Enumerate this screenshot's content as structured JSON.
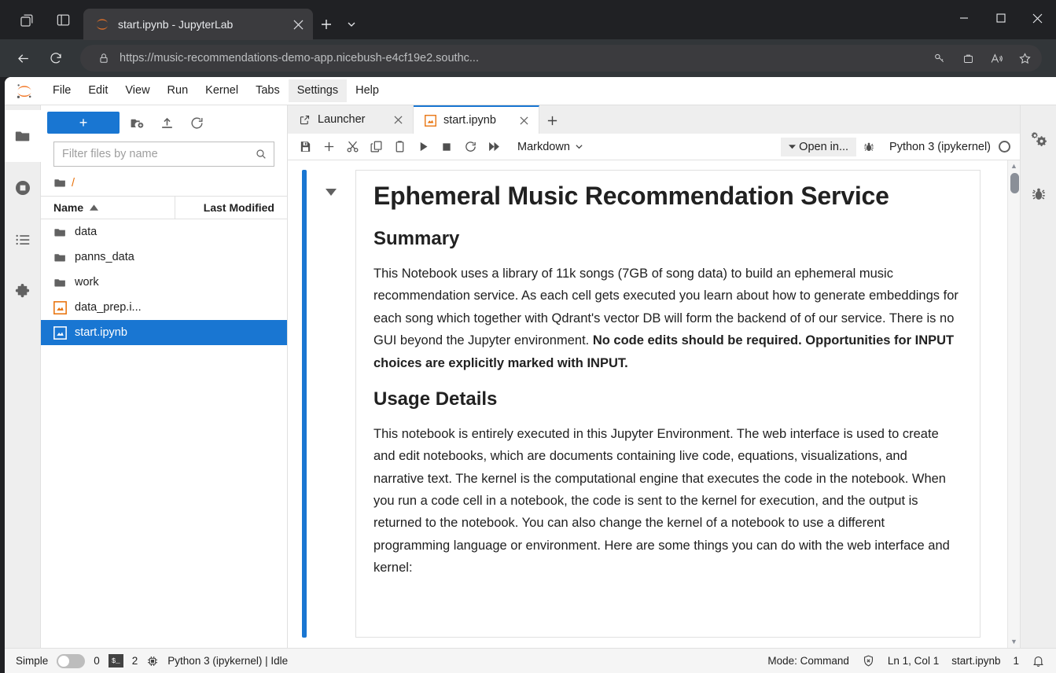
{
  "browser": {
    "tab_title": "start.ipynb - JupyterLab",
    "url": "https://music-recommendations-demo-app.nicebush-e4cf19e2.southc...",
    "icons": {
      "collections": "collections-icon",
      "split_screen": "split-screen-icon",
      "favicon": "jupyter-favicon",
      "tab_close": "close-icon",
      "new_tab": "new-tab-icon",
      "tab_list": "chevron-down-icon",
      "back": "back-arrow-icon",
      "reload": "reload-icon",
      "lock": "lock-icon",
      "key": "key-icon",
      "wallet": "wallet-icon",
      "read_aloud": "read-aloud-icon",
      "favorite": "star-icon",
      "minimize": "minimize-icon",
      "maximize": "maximize-icon",
      "close": "close-icon"
    }
  },
  "jupyter": {
    "menu": [
      {
        "label": "File",
        "active": false
      },
      {
        "label": "Edit",
        "active": false
      },
      {
        "label": "View",
        "active": false
      },
      {
        "label": "Run",
        "active": false
      },
      {
        "label": "Kernel",
        "active": false
      },
      {
        "label": "Tabs",
        "active": false
      },
      {
        "label": "Settings",
        "active": true
      },
      {
        "label": "Help",
        "active": false
      }
    ],
    "activity_bar": [
      {
        "name": "file-browser",
        "icon": "folder-icon",
        "active": true
      },
      {
        "name": "running-terminals",
        "icon": "stop-circle-icon",
        "active": false
      },
      {
        "name": "table-of-contents",
        "icon": "list-icon",
        "active": false
      },
      {
        "name": "extension-manager",
        "icon": "puzzle-icon",
        "active": false
      }
    ],
    "right_bar": [
      {
        "name": "property-inspector",
        "icon": "gears-icon"
      },
      {
        "name": "debugger",
        "icon": "bug-icon"
      }
    ],
    "file_browser": {
      "new_label": "+",
      "toolbar_icons": [
        "new-folder-icon",
        "upload-icon",
        "refresh-icon"
      ],
      "filter_placeholder": "Filter files by name",
      "filter_value": "",
      "breadcrumb": "/",
      "columns": {
        "name": "Name",
        "modified": "Last Modified"
      },
      "sort_indicator": "sort-ascending-icon",
      "files": [
        {
          "name": "data",
          "type": "folder",
          "selected": false
        },
        {
          "name": "panns_data",
          "type": "folder",
          "selected": false
        },
        {
          "name": "work",
          "type": "folder",
          "selected": false
        },
        {
          "name": "data_prep.i...",
          "type": "notebook",
          "selected": false
        },
        {
          "name": "start.ipynb",
          "type": "notebook",
          "selected": true
        }
      ]
    },
    "doc_tabs": [
      {
        "label": "Launcher",
        "icon": "launcher-icon",
        "active": false
      },
      {
        "label": "start.ipynb",
        "icon": "notebook-icon",
        "active": true
      }
    ],
    "notebook_toolbar": {
      "buttons": [
        {
          "name": "save-button",
          "icon": "save-icon"
        },
        {
          "name": "insert-cell-button",
          "icon": "plus-icon"
        },
        {
          "name": "cut-button",
          "icon": "scissors-icon"
        },
        {
          "name": "copy-button",
          "icon": "copy-icon"
        },
        {
          "name": "paste-button",
          "icon": "paste-icon"
        },
        {
          "name": "run-button",
          "icon": "play-icon"
        },
        {
          "name": "interrupt-button",
          "icon": "stop-icon"
        },
        {
          "name": "restart-button",
          "icon": "restart-icon"
        },
        {
          "name": "restart-run-all-button",
          "icon": "fast-forward-icon"
        }
      ],
      "cell_type": "Markdown",
      "open_in_label": "Open in...",
      "debug_icon": "bug-icon",
      "kernel_name": "Python 3 (ipykernel)",
      "kernel_status": "idle"
    },
    "notebook": {
      "title": "Ephemeral Music Recommendation Service",
      "summary_heading": "Summary",
      "summary_text_1": "This Notebook uses a library of 11k songs (7GB of song data) to build an ephemeral music recommendation service. As each cell gets executed you learn about how to generate embeddings for each song which together with Qdrant's vector DB will form the backend of of our service. There is no GUI beyond the Jupyter environment. ",
      "summary_text_bold": "No code edits should be required. Opportunities for INPUT choices are explicitly marked with INPUT.",
      "usage_heading": "Usage Details",
      "usage_text": "This notebook is entirely executed in this Jupyter Environment. The web interface is used to create and edit notebooks, which are documents containing live code, equations, visualizations, and narrative text. The kernel is the computational engine that executes the code in the notebook. When you run a code cell in a notebook, the code is sent to the kernel for execution, and the output is returned to the notebook. You can also change the kernel of a notebook to use a different programming language or environment. Here are some things you can do with the web interface and kernel:"
    },
    "status_bar": {
      "simple_label": "Simple",
      "simple_on": false,
      "kernels_count": "0",
      "terminals_count": "2",
      "kernel_status_text": "Python 3 (ipykernel) | Idle",
      "mode": "Mode: Command",
      "cursor": "Ln 1, Col 1",
      "filename": "start.ipynb",
      "notification_count": "1",
      "icons": {
        "terminal": "terminal-icon",
        "cpu": "cpu-icon",
        "trusted": "shield-x-icon",
        "bell": "bell-icon"
      }
    }
  },
  "colors": {
    "accent": "#1976d2",
    "jupyter_orange": "#e8710a",
    "chrome_bg": "#202124",
    "toolbar_bg": "#323639"
  }
}
